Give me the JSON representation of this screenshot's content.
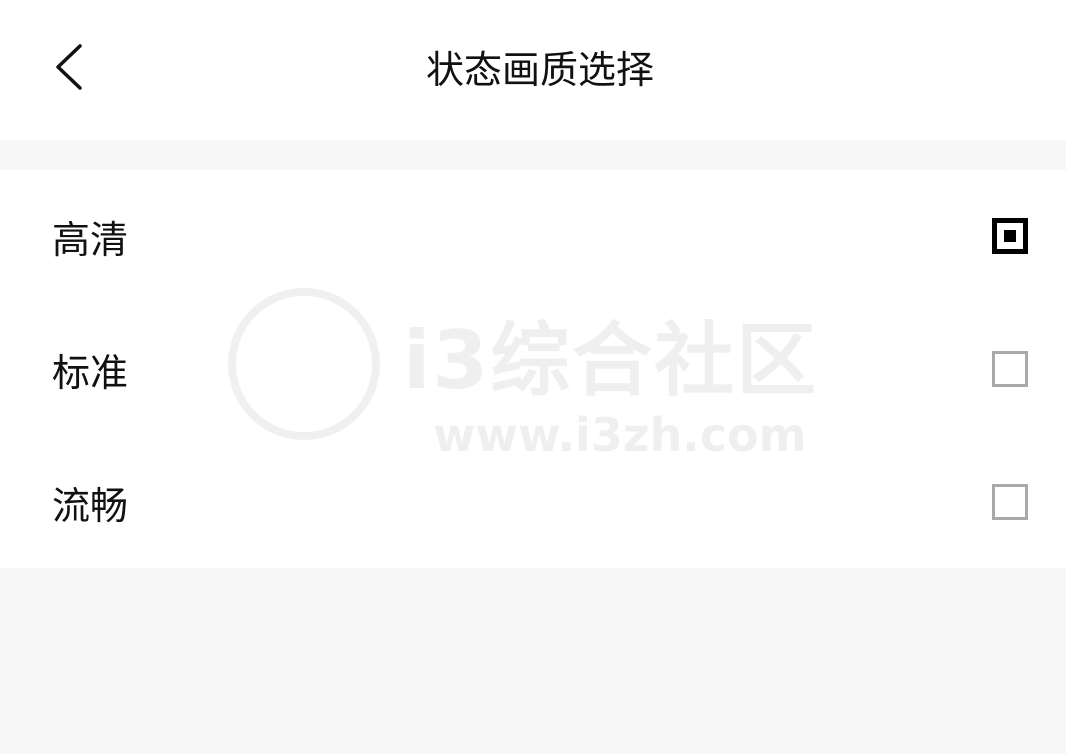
{
  "header": {
    "title": "状态画质选择",
    "back_icon": "chevron-left-icon"
  },
  "options": [
    {
      "label": "高清",
      "selected": true
    },
    {
      "label": "标准",
      "selected": false
    },
    {
      "label": "流畅",
      "selected": false
    }
  ],
  "watermark": {
    "brand": "i3综合社区",
    "url": "www.i3zh.com"
  },
  "colors": {
    "background": "#f7f7f7",
    "surface": "#ffffff",
    "text": "#111111",
    "checked": "#000000",
    "unchecked_border": "#a9a9a9"
  }
}
